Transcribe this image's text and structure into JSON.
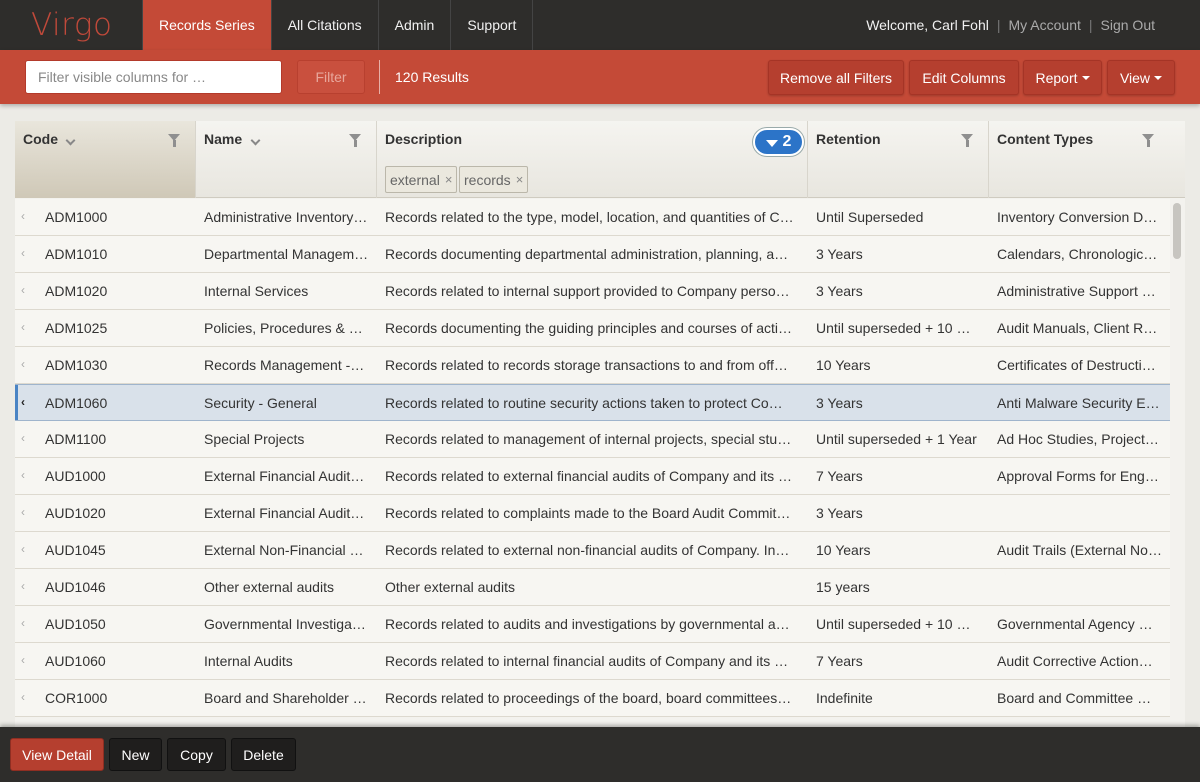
{
  "app": {
    "brand": "Virgo"
  },
  "nav": {
    "tabs": [
      {
        "label": "Records Series",
        "active": true
      },
      {
        "label": "All Citations",
        "active": false
      },
      {
        "label": "Admin",
        "active": false
      },
      {
        "label": "Support",
        "active": false
      }
    ],
    "welcome": "Welcome, Carl Fohl",
    "separator": "|",
    "my_account": "My Account",
    "sign_out": "Sign Out"
  },
  "toolbar": {
    "filter_placeholder": "Filter visible columns for …",
    "filter_label": "Filter",
    "results": "120 Results",
    "remove_filters": "Remove all Filters",
    "edit_columns": "Edit Columns",
    "report": "Report",
    "view": "View"
  },
  "grid": {
    "columns": [
      "Code",
      "Name",
      "Description",
      "Retention",
      "Content Types"
    ],
    "active_filter_count": "2",
    "description_filters": [
      "external",
      "records"
    ],
    "chip_remove": "×",
    "row_icon": "‹",
    "rows": [
      {
        "code": "ADM1000",
        "name": "Administrative Inventory…",
        "description": "Records related to the type, model, location, and quantities of C…",
        "retention": "Until Superseded",
        "content_types": "Inventory Conversion D…"
      },
      {
        "code": "ADM1010",
        "name": "Departmental Managem…",
        "description": "Records documenting departmental administration, planning, a…",
        "retention": "3 Years",
        "content_types": "Calendars, Chronologic…"
      },
      {
        "code": "ADM1020",
        "name": "Internal Services",
        "description": "Records related to internal support provided to Company perso…",
        "retention": "3 Years",
        "content_types": "Administrative Support …"
      },
      {
        "code": "ADM1025",
        "name": "Policies, Procedures & …",
        "description": "Records documenting the guiding principles and courses of acti…",
        "retention": "Until superseded + 10 …",
        "content_types": "Audit Manuals, Client R…"
      },
      {
        "code": "ADM1030",
        "name": "Records Management -…",
        "description": "Records related to records storage transactions to and from off…",
        "retention": "10 Years",
        "content_types": "Certificates of Destructi…"
      },
      {
        "code": "ADM1060",
        "name": "Security - General",
        "description": "Records related to routine security actions taken to protect Co…",
        "retention": "3 Years",
        "content_types": "Anti Malware Security E…",
        "selected": true
      },
      {
        "code": "ADM1100",
        "name": "Special Projects",
        "description": "Records related to management of internal projects, special stu…",
        "retention": "Until superseded + 1 Year",
        "content_types": "Ad Hoc Studies, Project…"
      },
      {
        "code": "AUD1000",
        "name": "External Financial Audit…",
        "description": "Records related to external financial audits of Company and its …",
        "retention": "7 Years",
        "content_types": "Approval Forms for Eng…"
      },
      {
        "code": "AUD1020",
        "name": "External Financial Audit…",
        "description": "Records related to complaints made to the Board Audit Commit…",
        "retention": "3 Years",
        "content_types": ""
      },
      {
        "code": "AUD1045",
        "name": "External Non-Financial …",
        "description": "Records related to external non-financial audits of Company. In…",
        "retention": "10 Years",
        "content_types": "Audit Trails (External No…"
      },
      {
        "code": "AUD1046",
        "name": "Other external audits",
        "description": "Other external audits",
        "retention": "15 years",
        "content_types": ""
      },
      {
        "code": "AUD1050",
        "name": "Governmental Investiga…",
        "description": "Records related to audits and investigations by governmental a…",
        "retention": "Until superseded + 10 …",
        "content_types": "Governmental Agency …"
      },
      {
        "code": "AUD1060",
        "name": "Internal Audits",
        "description": "Records related to internal financial audits of Company and its …",
        "retention": "7 Years",
        "content_types": "Audit Corrective Action…"
      },
      {
        "code": "COR1000",
        "name": "Board and Shareholder …",
        "description": "Records related to proceedings of the board, board committees…",
        "retention": "Indefinite",
        "content_types": "Board and Committee …"
      }
    ]
  },
  "bottombar": {
    "view_detail": "View Detail",
    "new": "New",
    "copy": "Copy",
    "delete": "Delete"
  },
  "colors": {
    "brand_red": "#c44a37",
    "nav_dark": "#2e2d2b",
    "selected_row": "#d9e1ea",
    "filter_badge": "#2c74c8"
  }
}
